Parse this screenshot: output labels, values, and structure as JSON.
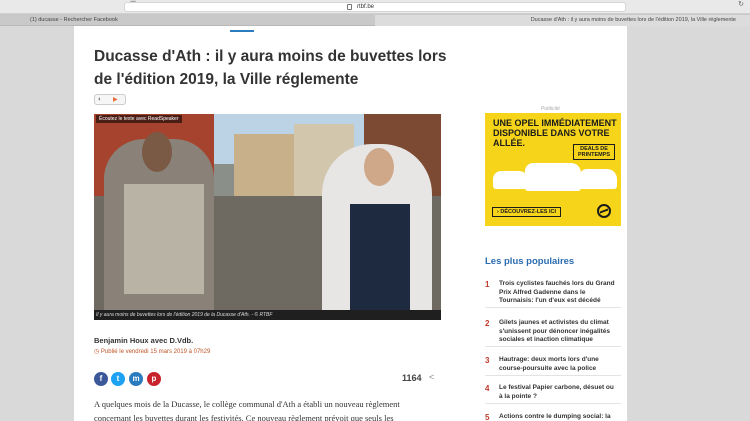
{
  "browser": {
    "url": "rtbf.be",
    "tab_left": "(1) ducasse - Rechercher Facebook",
    "tab_right": "Ducasse d'Ath : il y aura moins de buvettes lors de l'édition 2019, la Ville réglemente"
  },
  "article": {
    "title": "Ducasse d'Ath : il y aura moins de buvettes lors de l'édition 2019, la Ville réglemente",
    "readspeaker_label": "Écoutez le texte avec ReadSpeaker",
    "photo_caption": "Il y aura moins de buvettes lors de l'édition 2019 de la Ducasse d'Ath. - © RTBF",
    "author": "Benjamin Houx avec D.Vdb.",
    "published": "Publié le vendredi 15 mars 2019 à 07h29",
    "share_count": "1164",
    "body": "A quelques mois de la Ducasse, le collège communal d'Ath a établi un nouveau règlement concernant les buvettes durant les festivités. Ce nouveau règlement prévoit que seuls les"
  },
  "share_icons": [
    "facebook-icon",
    "twitter-icon",
    "messenger-icon",
    "pinterest-icon"
  ],
  "ad": {
    "label": "Publicité",
    "headline": "UNE OPEL IMMÉDIATEMENT DISPONIBLE DANS VOTRE ALLÉE.",
    "deals": "DEALS DE PRINTEMPS",
    "cta": "› DÉCOUVREZ-LES ICI",
    "color": "#f5d41a"
  },
  "popular": {
    "title": "Les plus populaires",
    "items": [
      {
        "num": "1",
        "text": "Trois cyclistes fauchés lors du Grand Prix Alfred Gadenne dans le Tournaisis: l'un d'eux est décédé"
      },
      {
        "num": "2",
        "text": "Gilets jaunes et activistes du climat s'unissent pour dénoncer inégalités sociales et inaction climatique"
      },
      {
        "num": "3",
        "text": "Hautrage: deux morts lors d'une course-poursuite avec la police"
      },
      {
        "num": "4",
        "text": "Le festival Papier carbone, désuet ou à la pointe ?"
      },
      {
        "num": "5",
        "text": "Actions contre le dumping social: la"
      }
    ]
  },
  "colors": {
    "accent": "#2b6cb0",
    "published": "#c0552a"
  }
}
